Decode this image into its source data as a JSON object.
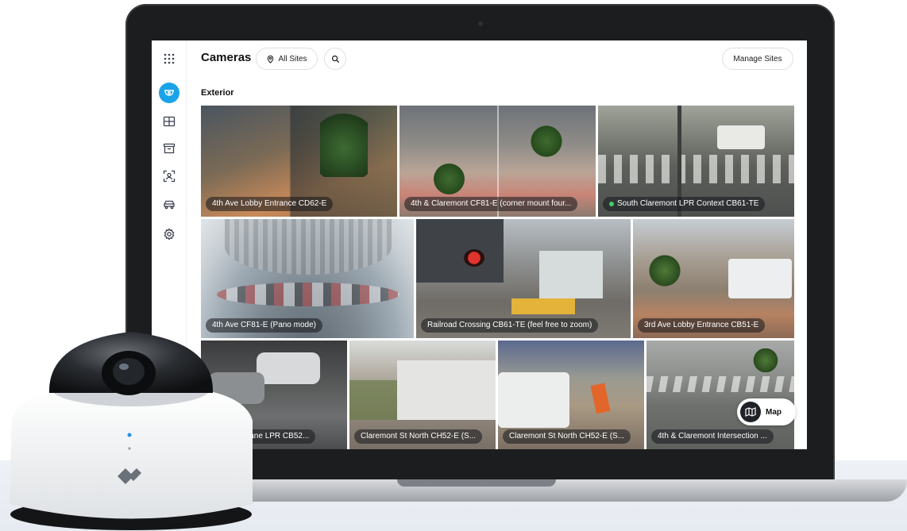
{
  "app": {
    "title": "Cameras",
    "site_filter": "All Sites",
    "manage_button": "Manage Sites",
    "map_button": "Map",
    "section_title": "Exterior"
  },
  "sidebar": {
    "icons": [
      "apps-grid-icon",
      "camera-dome-icon",
      "grid-layout-icon",
      "archive-icon",
      "face-scan-icon",
      "vehicle-icon",
      "settings-gear-icon"
    ]
  },
  "cameras": [
    {
      "label": "4th Ave Lobby Entrance CD62-E",
      "status": "none"
    },
    {
      "label": "4th & Claremont CF81-E (corner mount four...",
      "status": "none"
    },
    {
      "label": "South Claremont LPR Context CB61-TE",
      "status": "online"
    },
    {
      "label": "4th Ave CF81-E (Pano mode)",
      "status": "none"
    },
    {
      "label": "Railroad Crossing CB61-TE (feel free to zoom)",
      "status": "none"
    },
    {
      "label": "3rd Ave Lobby Entrance CB51-E",
      "status": "none"
    },
    {
      "label": "e - Triple Lane LPR CB52...",
      "status": "none"
    },
    {
      "label": "Claremont St North CH52-E (S...",
      "status": "none"
    },
    {
      "label": "Claremont St North CH52-E (S...",
      "status": "none"
    },
    {
      "label": "4th & Claremont Intersection ...",
      "status": "none"
    }
  ],
  "colors": {
    "accent": "#1aa3e8",
    "status_online": "#3ecf6b",
    "laptop_bezel": "#1c1d1f"
  }
}
